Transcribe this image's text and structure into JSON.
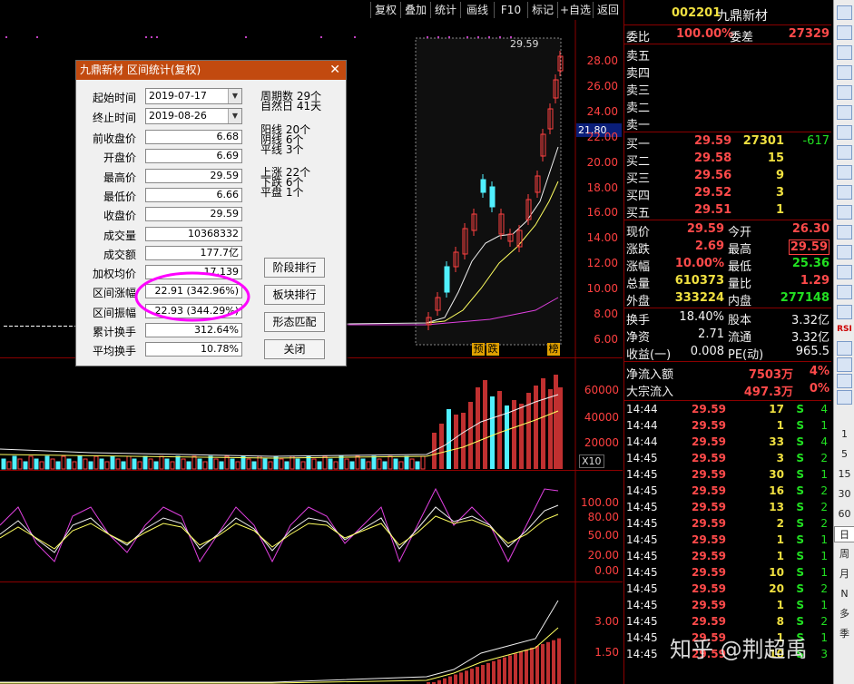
{
  "toolbar": {
    "buttons": [
      "复权",
      "叠加",
      "统计",
      "画线",
      "F10",
      "标记",
      "+自选",
      "返回"
    ]
  },
  "chart": {
    "price_ticks": [
      "28.00",
      "26.00",
      "24.00",
      "22.00",
      "20.00",
      "18.00",
      "16.00",
      "14.00",
      "12.00",
      "10.00",
      "8.00",
      "6.00"
    ],
    "current_price_tag": "21.80",
    "high_marker": "29.59",
    "markers": [
      "预",
      "跌",
      "榜"
    ],
    "volume_ticks": [
      "60000",
      "40000",
      "20000"
    ],
    "volume_unit": "X10",
    "kdj_ticks": [
      "100.00",
      "80.00",
      "50.00",
      "20.00",
      "0.00"
    ],
    "lower_ticks": [
      "3.00",
      "1.50"
    ],
    "watermark": "知乎 @荆超禹"
  },
  "dialog": {
    "title": "九鼎新材 区间统计(复权)",
    "start_label": "起始时间",
    "start_value": "2019-07-17",
    "end_label": "终止时间",
    "end_value": "2019-08-26",
    "fields": [
      {
        "label": "前收盘价",
        "value": "6.68"
      },
      {
        "label": "开盘价",
        "value": "6.69"
      },
      {
        "label": "最高价",
        "value": "29.59"
      },
      {
        "label": "最低价",
        "value": "6.66"
      },
      {
        "label": "收盘价",
        "value": "29.59"
      },
      {
        "label": "成交量",
        "value": "10368332"
      },
      {
        "label": "成交额",
        "value": "177.7亿"
      },
      {
        "label": "加权均价",
        "value": "17.139"
      },
      {
        "label": "区间涨幅",
        "value": "22.91 (342.96%)"
      },
      {
        "label": "区间振幅",
        "value": "22.93 (344.29%)"
      },
      {
        "label": "累计换手",
        "value": "312.64%"
      },
      {
        "label": "平均换手",
        "value": "10.78%"
      }
    ],
    "stats": {
      "period_count": "周期数 29个",
      "natural_days": "自然日 41天",
      "yang": "阳线 20个",
      "yin": "阴线 6个",
      "flat_line": "平线 3个",
      "up": "上涨 22个",
      "down": "下跌 6个",
      "flat": "平盘 1个"
    },
    "buttons": [
      "阶段排行",
      "板块排行",
      "形态匹配",
      "关闭"
    ]
  },
  "quote": {
    "code": "002201",
    "name": "九鼎新材",
    "weibi_label": "委比",
    "weibi_value": "100.00%",
    "weicha_label": "委差",
    "weicha_value": "27329",
    "sells": [
      "卖五",
      "卖四",
      "卖三",
      "卖二",
      "卖一"
    ],
    "buys": [
      {
        "label": "买一",
        "price": "29.59",
        "vol": "27301",
        "chg": "-617"
      },
      {
        "label": "买二",
        "price": "29.58",
        "vol": "15",
        "chg": ""
      },
      {
        "label": "买三",
        "price": "29.56",
        "vol": "9",
        "chg": ""
      },
      {
        "label": "买四",
        "price": "29.52",
        "vol": "3",
        "chg": ""
      },
      {
        "label": "买五",
        "price": "29.51",
        "vol": "1",
        "chg": ""
      }
    ],
    "stats": [
      {
        "l1": "现价",
        "v1": "29.59",
        "l2": "今开",
        "v2": "26.30"
      },
      {
        "l1": "涨跌",
        "v1": "2.69",
        "l2": "最高",
        "v2": "29.59"
      },
      {
        "l1": "涨幅",
        "v1": "10.00%",
        "l2": "最低",
        "v2": "25.36"
      },
      {
        "l1": "总量",
        "v1": "610373",
        "l2": "量比",
        "v2": "1.29"
      },
      {
        "l1": "外盘",
        "v1": "333224",
        "l2": "内盘",
        "v2": "277148"
      }
    ],
    "stats2": [
      {
        "l1": "换手",
        "v1": "18.40%",
        "l2": "股本",
        "v2": "3.32亿"
      },
      {
        "l1": "净资",
        "v1": "2.71",
        "l2": "流通",
        "v2": "3.32亿"
      },
      {
        "l1": "收益(一)",
        "v1": "0.008",
        "l2": "PE(动)",
        "v2": "965.5"
      }
    ],
    "flows": [
      {
        "label": "净流入额",
        "value": "7503万",
        "pct": "4%"
      },
      {
        "label": "大宗流入",
        "value": "497.3万",
        "pct": "0%"
      }
    ],
    "ticks": [
      {
        "t": "14:44",
        "p": "29.59",
        "v": "17",
        "s": "S",
        "n": "4"
      },
      {
        "t": "14:44",
        "p": "29.59",
        "v": "1",
        "s": "S",
        "n": "1"
      },
      {
        "t": "14:44",
        "p": "29.59",
        "v": "33",
        "s": "S",
        "n": "4"
      },
      {
        "t": "14:45",
        "p": "29.59",
        "v": "3",
        "s": "S",
        "n": "2"
      },
      {
        "t": "14:45",
        "p": "29.59",
        "v": "30",
        "s": "S",
        "n": "1"
      },
      {
        "t": "14:45",
        "p": "29.59",
        "v": "16",
        "s": "S",
        "n": "2"
      },
      {
        "t": "14:45",
        "p": "29.59",
        "v": "13",
        "s": "S",
        "n": "2"
      },
      {
        "t": "14:45",
        "p": "29.59",
        "v": "2",
        "s": "S",
        "n": "2"
      },
      {
        "t": "14:45",
        "p": "29.59",
        "v": "1",
        "s": "S",
        "n": "1"
      },
      {
        "t": "14:45",
        "p": "29.59",
        "v": "1",
        "s": "S",
        "n": "1"
      },
      {
        "t": "14:45",
        "p": "29.59",
        "v": "10",
        "s": "S",
        "n": "1"
      },
      {
        "t": "14:45",
        "p": "29.59",
        "v": "20",
        "s": "S",
        "n": "2"
      },
      {
        "t": "14:45",
        "p": "29.59",
        "v": "1",
        "s": "S",
        "n": "1"
      },
      {
        "t": "14:45",
        "p": "29.59",
        "v": "8",
        "s": "S",
        "n": "2"
      },
      {
        "t": "14:45",
        "p": "29.59",
        "v": "1",
        "s": "S",
        "n": "1"
      },
      {
        "t": "14:45",
        "p": "29.59",
        "v": "10",
        "s": "S",
        "n": "3"
      }
    ]
  },
  "sidebar": {
    "periods": [
      "1",
      "5",
      "15",
      "30",
      "60",
      "日",
      "周",
      "月",
      "N",
      "多",
      "季"
    ],
    "rsi_label": "RSI"
  }
}
